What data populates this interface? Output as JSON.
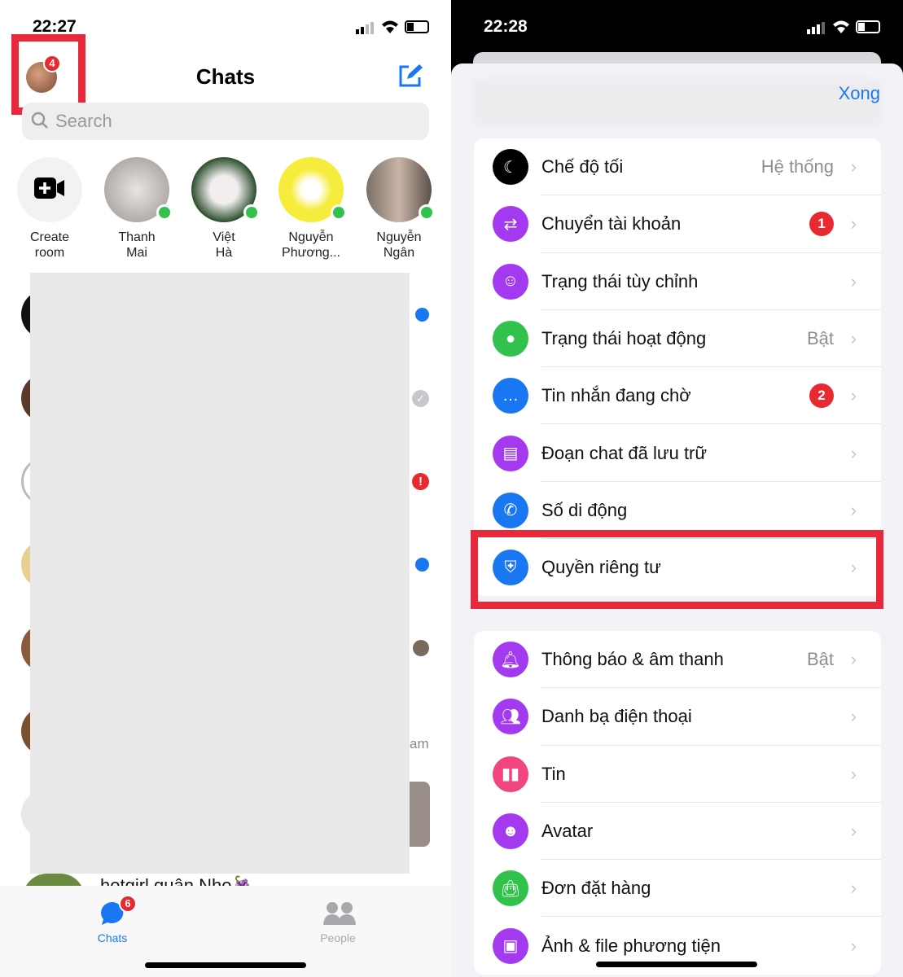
{
  "left": {
    "status_time": "22:27",
    "profile_badge": "4",
    "title": "Chats",
    "search_placeholder": "Search",
    "stories": [
      {
        "name": "Create\nroom",
        "line1": "Create",
        "line2": "room"
      },
      {
        "line1": "Thanh",
        "line2": "Mai",
        "online": true
      },
      {
        "line1": "Việt",
        "line2": "Hà",
        "online": true
      },
      {
        "line1": "Nguyễn",
        "line2": "Phương...",
        "online": true
      },
      {
        "line1": "Nguyễn",
        "line2": "Ngân",
        "online": true
      }
    ],
    "partial_chat_name": "hotgirl quận Nho🍇",
    "partial_time": "am",
    "tabs": [
      {
        "label": "Chats",
        "badge": "6",
        "active": true
      },
      {
        "label": "People",
        "active": false
      }
    ],
    "highlight_color": "#e8293b"
  },
  "right": {
    "status_time": "22:28",
    "done_label": "Xong",
    "group1": [
      {
        "label": "Chế độ tối",
        "value": "Hệ thống",
        "icon": "moon-icon",
        "color": "#000000"
      },
      {
        "label": "Chuyển tài khoản",
        "badge": "1",
        "icon": "switch-account-icon",
        "color": "#a33af0"
      },
      {
        "label": "Trạng thái tùy chỉnh",
        "icon": "smiley-icon",
        "color": "#a33af0"
      },
      {
        "label": "Trạng thái hoạt động",
        "value": "Bật",
        "icon": "active-status-icon",
        "color": "#31c24d"
      },
      {
        "label": "Tin nhắn đang chờ",
        "badge": "2",
        "icon": "message-pending-icon",
        "color": "#1a77f2"
      },
      {
        "label": "Đoạn chat đã lưu trữ",
        "icon": "archive-icon",
        "color": "#a33af0"
      },
      {
        "label": "Số di động",
        "icon": "phone-icon",
        "color": "#1a77f2"
      },
      {
        "label": "Quyền riêng tư",
        "icon": "shield-icon",
        "color": "#1a77f2",
        "highlighted": true
      }
    ],
    "group2": [
      {
        "label": "Thông báo & âm thanh",
        "value": "Bật",
        "icon": "bell-icon",
        "color": "#a33af0"
      },
      {
        "label": "Danh bạ điện thoại",
        "icon": "contacts-icon",
        "color": "#a33af0"
      },
      {
        "label": "Tin",
        "icon": "stories-icon",
        "color": "#f0457f"
      },
      {
        "label": "Avatar",
        "icon": "avatar-icon",
        "color": "#a33af0"
      },
      {
        "label": "Đơn đặt hàng",
        "icon": "shopping-bag-icon",
        "color": "#31c24d"
      },
      {
        "label": "Ảnh & file phương tiện",
        "icon": "photo-icon",
        "color": "#a33af0"
      }
    ]
  }
}
